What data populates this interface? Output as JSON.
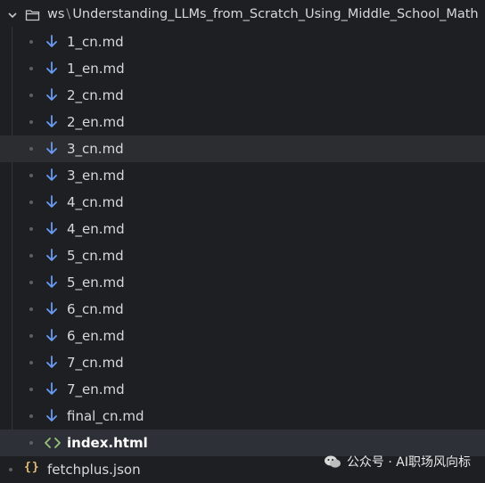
{
  "explorer": {
    "folder": {
      "root": "ws",
      "separator": "\\",
      "name": "Understanding_LLMs_from_Scratch_Using_Middle_School_Math"
    },
    "files": [
      {
        "name": "1_cn.md",
        "type": "markdown"
      },
      {
        "name": "1_en.md",
        "type": "markdown"
      },
      {
        "name": "2_cn.md",
        "type": "markdown"
      },
      {
        "name": "2_en.md",
        "type": "markdown"
      },
      {
        "name": "3_cn.md",
        "type": "markdown",
        "hovered": true
      },
      {
        "name": "3_en.md",
        "type": "markdown"
      },
      {
        "name": "4_cn.md",
        "type": "markdown"
      },
      {
        "name": "4_en.md",
        "type": "markdown"
      },
      {
        "name": "5_cn.md",
        "type": "markdown"
      },
      {
        "name": "5_en.md",
        "type": "markdown"
      },
      {
        "name": "6_cn.md",
        "type": "markdown"
      },
      {
        "name": "6_en.md",
        "type": "markdown"
      },
      {
        "name": "7_cn.md",
        "type": "markdown"
      },
      {
        "name": "7_en.md",
        "type": "markdown"
      },
      {
        "name": "final_cn.md",
        "type": "markdown"
      },
      {
        "name": "index.html",
        "type": "html",
        "selected": true
      }
    ],
    "root_files": [
      {
        "name": "fetchplus.json",
        "type": "json",
        "icon": "{}"
      }
    ]
  },
  "watermark": {
    "text": "公众号 · AI职场风向标"
  },
  "colors": {
    "background": "#1e1f22",
    "markdown_icon": "#6a9bf4",
    "html_icon": "#98c379",
    "json_icon": "#e5c07b"
  }
}
